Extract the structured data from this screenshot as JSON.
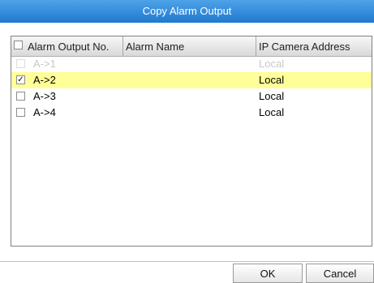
{
  "dialog": {
    "title": "Copy Alarm Output"
  },
  "table": {
    "headers": {
      "alarm_output_no": "Alarm Output No.",
      "alarm_name": "Alarm Name",
      "ip_camera_address": "IP Camera Address"
    },
    "rows": [
      {
        "no": "A->1",
        "name": "",
        "ip": "Local",
        "checked": false,
        "disabled": true,
        "selected": false
      },
      {
        "no": "A->2",
        "name": "",
        "ip": "Local",
        "checked": true,
        "disabled": false,
        "selected": true
      },
      {
        "no": "A->3",
        "name": "",
        "ip": "Local",
        "checked": false,
        "disabled": false,
        "selected": false
      },
      {
        "no": "A->4",
        "name": "",
        "ip": "Local",
        "checked": false,
        "disabled": false,
        "selected": false
      }
    ],
    "check_mark": "✓"
  },
  "buttons": {
    "ok": "OK",
    "cancel": "Cancel"
  },
  "colors": {
    "title_bar": "#1f79cf",
    "selected_row": "#ffff99"
  }
}
